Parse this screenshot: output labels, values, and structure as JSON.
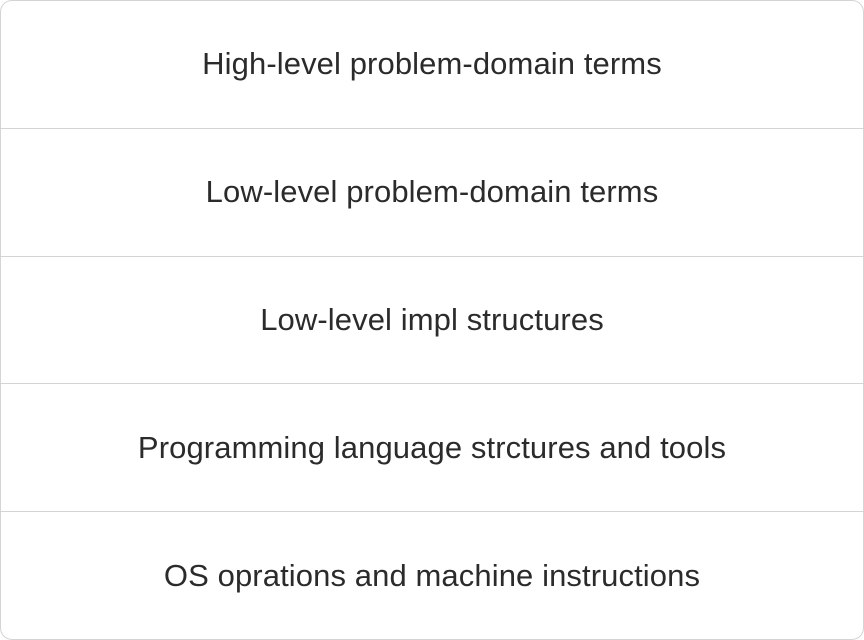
{
  "layers": [
    {
      "label": "High-level problem-domain terms"
    },
    {
      "label": "Low-level problem-domain terms"
    },
    {
      "label": "Low-level impl structures"
    },
    {
      "label": "Programming language strctures and tools"
    },
    {
      "label": "OS oprations and machine instructions"
    }
  ],
  "colors": {
    "border": "#d4d4d4",
    "text": "#2b2b2b",
    "background": "#ffffff"
  }
}
